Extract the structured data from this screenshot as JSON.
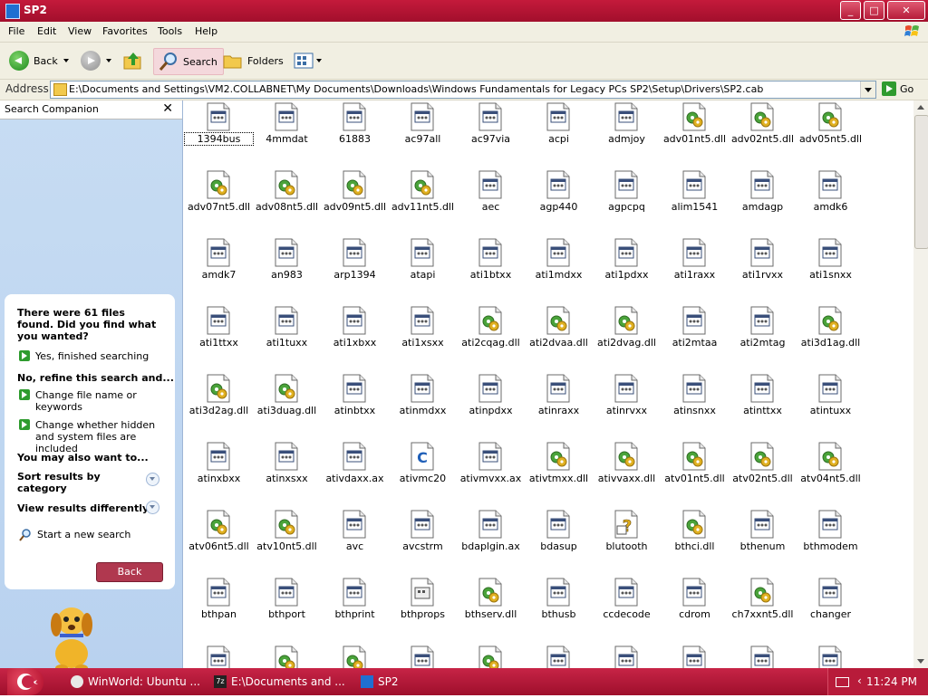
{
  "window": {
    "title": "SP2"
  },
  "menubar": {
    "items": [
      "File",
      "Edit",
      "View",
      "Favorites",
      "Tools",
      "Help"
    ]
  },
  "toolbar": {
    "back_label": "Back",
    "search_label": "Search",
    "folders_label": "Folders"
  },
  "address": {
    "label": "Address",
    "path": "E:\\Documents and Settings\\VM2.COLLABNET\\My Documents\\Downloads\\Windows Fundamentals for Legacy PCs SP2\\Setup\\Drivers\\SP2.cab",
    "go_label": "Go"
  },
  "companion": {
    "title": "Search Companion",
    "close": "✕",
    "result_text": "There were 61 files found. Did you find what you wanted?",
    "yes_label": "Yes, finished searching",
    "refine_heading": "No, refine this search and...",
    "option1": "Change file name or keywords",
    "option2": "Change whether hidden and system files are included",
    "also_heading": "You may also want to...",
    "sort_label": "Sort results by category",
    "view_label": "View results differently",
    "new_search_label": "Start a new search",
    "back_label": "Back"
  },
  "files": [
    {
      "name": "1394bus",
      "type": "sys"
    },
    {
      "name": "4mmdat",
      "type": "sys"
    },
    {
      "name": "61883",
      "type": "sys"
    },
    {
      "name": "ac97all",
      "type": "sys"
    },
    {
      "name": "ac97via",
      "type": "sys"
    },
    {
      "name": "acpi",
      "type": "sys"
    },
    {
      "name": "admjoy",
      "type": "sys"
    },
    {
      "name": "adv01nt5.dll",
      "type": "dll"
    },
    {
      "name": "adv02nt5.dll",
      "type": "dll"
    },
    {
      "name": "adv05nt5.dll",
      "type": "dll"
    },
    {
      "name": "adv07nt5.dll",
      "type": "dll"
    },
    {
      "name": "adv08nt5.dll",
      "type": "dll"
    },
    {
      "name": "adv09nt5.dll",
      "type": "dll"
    },
    {
      "name": "adv11nt5.dll",
      "type": "dll"
    },
    {
      "name": "aec",
      "type": "sys"
    },
    {
      "name": "agp440",
      "type": "sys"
    },
    {
      "name": "agpcpq",
      "type": "sys"
    },
    {
      "name": "alim1541",
      "type": "sys"
    },
    {
      "name": "amdagp",
      "type": "sys"
    },
    {
      "name": "amdk6",
      "type": "sys"
    },
    {
      "name": "amdk7",
      "type": "sys"
    },
    {
      "name": "an983",
      "type": "sys"
    },
    {
      "name": "arp1394",
      "type": "sys"
    },
    {
      "name": "atapi",
      "type": "sys"
    },
    {
      "name": "ati1btxx",
      "type": "sys"
    },
    {
      "name": "ati1mdxx",
      "type": "sys"
    },
    {
      "name": "ati1pdxx",
      "type": "sys"
    },
    {
      "name": "ati1raxx",
      "type": "sys"
    },
    {
      "name": "ati1rvxx",
      "type": "sys"
    },
    {
      "name": "ati1snxx",
      "type": "sys"
    },
    {
      "name": "ati1ttxx",
      "type": "sys"
    },
    {
      "name": "ati1tuxx",
      "type": "sys"
    },
    {
      "name": "ati1xbxx",
      "type": "sys"
    },
    {
      "name": "ati1xsxx",
      "type": "sys"
    },
    {
      "name": "ati2cqag.dll",
      "type": "dll"
    },
    {
      "name": "ati2dvaa.dll",
      "type": "dll"
    },
    {
      "name": "ati2dvag.dll",
      "type": "dll"
    },
    {
      "name": "ati2mtaa",
      "type": "sys"
    },
    {
      "name": "ati2mtag",
      "type": "sys"
    },
    {
      "name": "ati3d1ag.dll",
      "type": "dll"
    },
    {
      "name": "ati3d2ag.dll",
      "type": "dll"
    },
    {
      "name": "ati3duag.dll",
      "type": "dll"
    },
    {
      "name": "atinbtxx",
      "type": "sys"
    },
    {
      "name": "atinmdxx",
      "type": "sys"
    },
    {
      "name": "atinpdxx",
      "type": "sys"
    },
    {
      "name": "atinraxx",
      "type": "sys"
    },
    {
      "name": "atinrvxx",
      "type": "sys"
    },
    {
      "name": "atinsnxx",
      "type": "sys"
    },
    {
      "name": "atinttxx",
      "type": "sys"
    },
    {
      "name": "atintuxx",
      "type": "sys"
    },
    {
      "name": "atinxbxx",
      "type": "sys"
    },
    {
      "name": "atinxsxx",
      "type": "sys"
    },
    {
      "name": "ativdaxx.ax",
      "type": "sys"
    },
    {
      "name": "ativmc20",
      "type": "c"
    },
    {
      "name": "ativmvxx.ax",
      "type": "sys"
    },
    {
      "name": "ativtmxx.dll",
      "type": "dll"
    },
    {
      "name": "ativvaxx.dll",
      "type": "dll"
    },
    {
      "name": "atv01nt5.dll",
      "type": "dll"
    },
    {
      "name": "atv02nt5.dll",
      "type": "dll"
    },
    {
      "name": "atv04nt5.dll",
      "type": "dll"
    },
    {
      "name": "atv06nt5.dll",
      "type": "dll"
    },
    {
      "name": "atv10nt5.dll",
      "type": "dll"
    },
    {
      "name": "avc",
      "type": "sys"
    },
    {
      "name": "avcstrm",
      "type": "sys"
    },
    {
      "name": "bdaplgin.ax",
      "type": "sys"
    },
    {
      "name": "bdasup",
      "type": "sys"
    },
    {
      "name": "blutooth",
      "type": "help"
    },
    {
      "name": "bthci.dll",
      "type": "dll"
    },
    {
      "name": "bthenum",
      "type": "sys"
    },
    {
      "name": "bthmodem",
      "type": "sys"
    },
    {
      "name": "bthpan",
      "type": "sys"
    },
    {
      "name": "bthport",
      "type": "sys"
    },
    {
      "name": "bthprint",
      "type": "sys"
    },
    {
      "name": "bthprops",
      "type": "cpl"
    },
    {
      "name": "bthserv.dll",
      "type": "dll"
    },
    {
      "name": "bthusb",
      "type": "sys"
    },
    {
      "name": "ccdecode",
      "type": "sys"
    },
    {
      "name": "cdrom",
      "type": "sys"
    },
    {
      "name": "ch7xxnt5.dll",
      "type": "dll"
    },
    {
      "name": "changer",
      "type": "sys"
    },
    {
      "name": "",
      "type": "sys"
    },
    {
      "name": "",
      "type": "dll"
    },
    {
      "name": "",
      "type": "dll"
    },
    {
      "name": "",
      "type": "sys"
    },
    {
      "name": "",
      "type": "dll"
    },
    {
      "name": "",
      "type": "sys"
    },
    {
      "name": "",
      "type": "sys"
    },
    {
      "name": "",
      "type": "sys"
    },
    {
      "name": "",
      "type": "sys"
    },
    {
      "name": "",
      "type": "sys"
    }
  ],
  "taskbar": {
    "items": [
      {
        "label": "WinWorld: Ubuntu ...",
        "icon": "browser-icon"
      },
      {
        "label": "E:\\Documents and ...",
        "icon": "7zip-icon"
      },
      {
        "label": "SP2",
        "icon": "folder-window-icon"
      }
    ],
    "clock": "11:24 PM"
  },
  "colors": {
    "theme_red": "#c41a3b",
    "taskbar_red": "#9e0f2c",
    "panel_blue": "#c7dcf3"
  }
}
